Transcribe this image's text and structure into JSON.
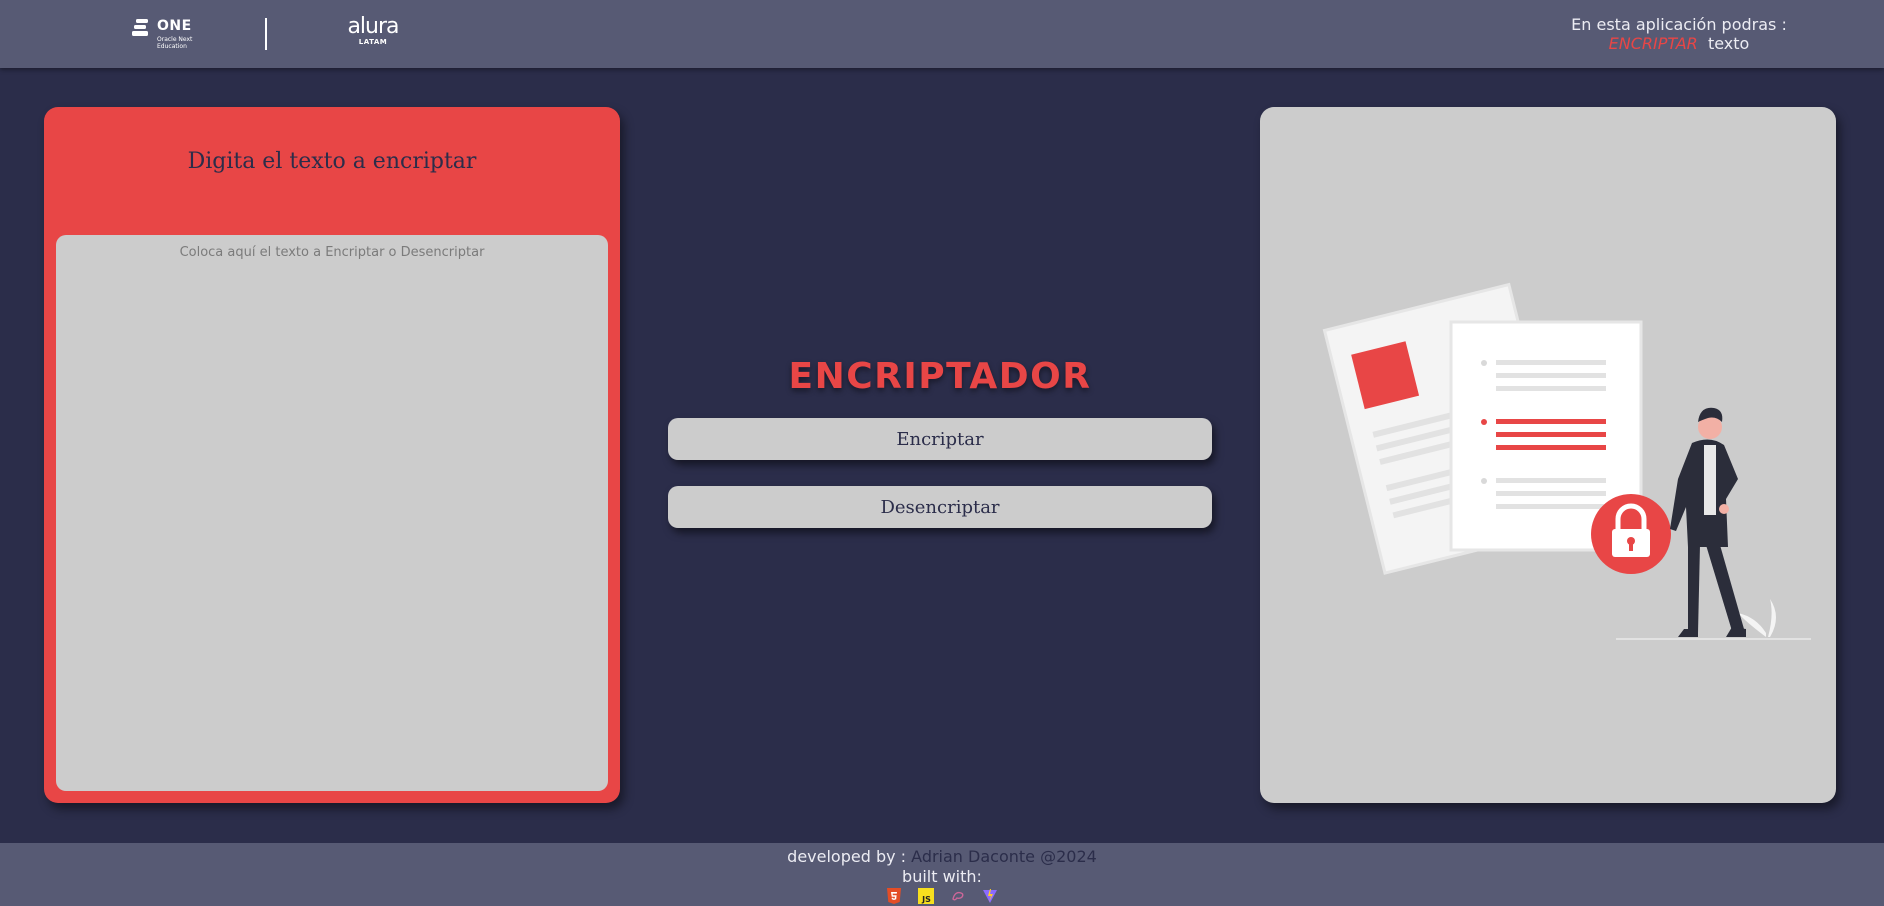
{
  "header": {
    "logo_one": {
      "big": "ONE",
      "line1": "Oracle Next",
      "line2": "Education"
    },
    "logo_alura": {
      "name": "alura",
      "region": "LATAM"
    },
    "info_line1": "En esta aplicación podras :",
    "info_highlight": "ENCRIPTAR",
    "info_suffix": "texto"
  },
  "left_panel": {
    "title": "Digita el texto a encriptar",
    "textarea_placeholder": "Coloca aquí el texto a Encriptar o Desencriptar",
    "textarea_value": ""
  },
  "center": {
    "title": "ENCRIPTADOR",
    "encrypt_label": "Encriptar",
    "decrypt_label": "Desencriptar"
  },
  "footer": {
    "developed_by": "developed by :",
    "author": "Adrian Daconte @2024",
    "built_with": "built with:",
    "tech_icons": [
      "html5-icon",
      "javascript-icon",
      "sass-icon",
      "vite-icon"
    ]
  },
  "colors": {
    "accent": "#e84646",
    "background": "#2b2d4a",
    "bar": "#575a74",
    "panel_gray": "#cccccc"
  }
}
